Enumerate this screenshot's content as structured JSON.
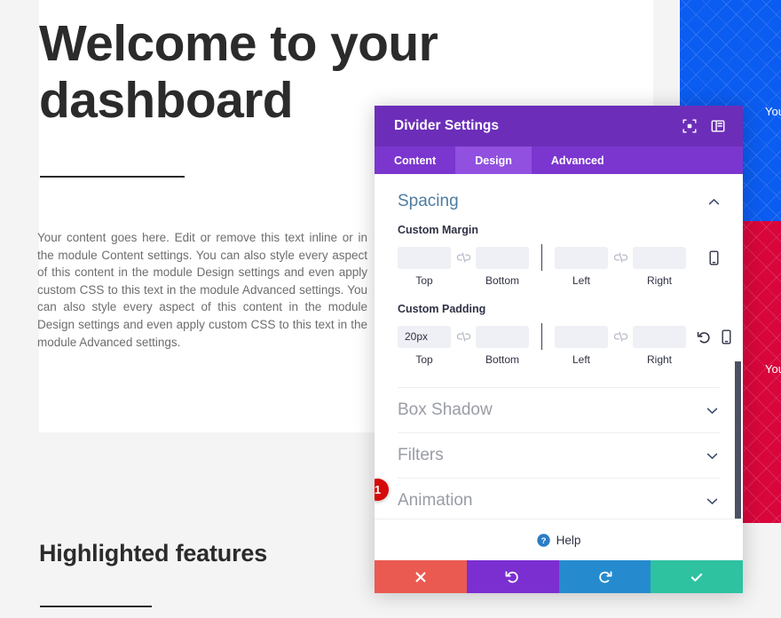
{
  "background": {
    "hero_title": "Welcome to your dashboard",
    "hero_paragraph": "Your content goes here. Edit or remove this text inline or in the module Content settings. You can also style every aspect of this content in the module Design settings and even apply custom CSS to this text in the module Advanced settings. You can also style every aspect of this content in the module Design settings and even apply custom CSS to this text in the module Advanced settings.",
    "features_title": "Highlighted features",
    "swatches": [
      {
        "name": "blue-block",
        "label": "You",
        "color": "#0b5cf0"
      },
      {
        "name": "red-block",
        "label": "You",
        "color": "#d8063b"
      }
    ]
  },
  "modal": {
    "title": "Divider Settings",
    "header_icons": [
      {
        "name": "focus-icon",
        "label": "Focus"
      },
      {
        "name": "layout-panel-icon",
        "label": "Layout"
      }
    ],
    "tabs": [
      {
        "label": "Content",
        "active": false
      },
      {
        "label": "Design",
        "active": true
      },
      {
        "label": "Advanced",
        "active": false
      }
    ],
    "spacing": {
      "title": "Spacing",
      "expanded": true,
      "custom_margin": {
        "label": "Custom Margin",
        "fields": [
          {
            "caption": "Top",
            "value": "",
            "placeholder": ""
          },
          {
            "caption": "Bottom",
            "value": "",
            "placeholder": ""
          },
          {
            "caption": "Left",
            "value": "",
            "placeholder": ""
          },
          {
            "caption": "Right",
            "value": "",
            "placeholder": ""
          }
        ],
        "actions": [
          {
            "name": "responsive-icon",
            "label": "Responsive"
          }
        ]
      },
      "custom_padding": {
        "label": "Custom Padding",
        "badge": "1",
        "fields": [
          {
            "caption": "Top",
            "value": "20px",
            "placeholder": ""
          },
          {
            "caption": "Bottom",
            "value": "",
            "placeholder": ""
          },
          {
            "caption": "Left",
            "value": "",
            "placeholder": ""
          },
          {
            "caption": "Right",
            "value": "",
            "placeholder": ""
          }
        ],
        "actions": [
          {
            "name": "reset-icon",
            "label": "Reset"
          },
          {
            "name": "responsive-icon",
            "label": "Responsive"
          }
        ]
      }
    },
    "closed_sections": [
      {
        "label": "Box Shadow"
      },
      {
        "label": "Filters"
      },
      {
        "label": "Animation"
      }
    ],
    "help": {
      "label": "Help"
    },
    "footer_buttons": [
      {
        "name": "cancel-button",
        "icon": "close-icon",
        "color": "#ea5a51"
      },
      {
        "name": "undo-button",
        "icon": "undo-icon",
        "color": "#7b2fd1"
      },
      {
        "name": "redo-button",
        "icon": "redo-icon",
        "color": "#258bce"
      },
      {
        "name": "save-button",
        "icon": "check-icon",
        "color": "#2ec2a0"
      }
    ],
    "colors": {
      "header": "#6c2eb9",
      "tab_bar": "#7b36cf",
      "tab_active": "#9150e0",
      "section_open": "#4e7ca1",
      "section_closed": "#9a9ca6",
      "badge": "#d60909"
    }
  }
}
